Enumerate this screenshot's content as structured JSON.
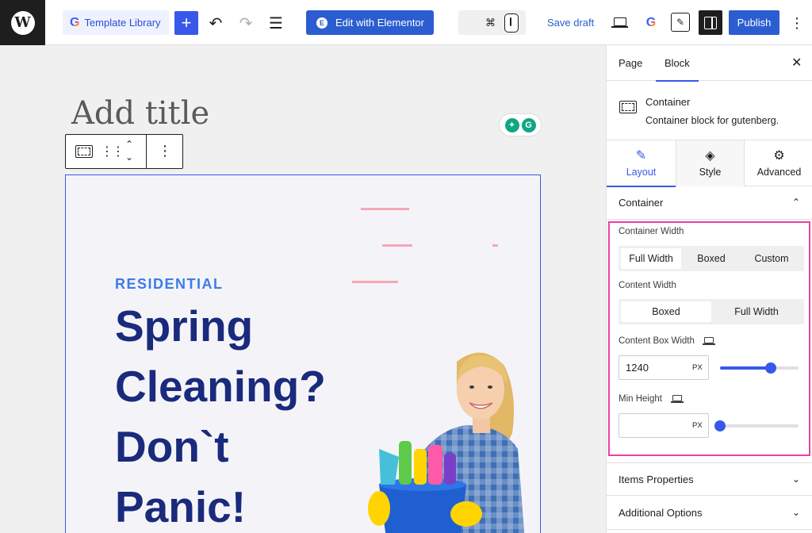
{
  "toolbar": {
    "template_library_label": "Template Library",
    "plus_label": "+",
    "undo_glyph": "↶",
    "redo_glyph": "↷",
    "list_view_glyph": "☰",
    "elementor_label": "Edit with Elementor",
    "cmd_key": "⌘",
    "save_draft_label": "Save draft",
    "publish_label": "Publish",
    "more_glyph": "⋮",
    "g_letter": "G",
    "pen_glyph": "✎",
    "wp_letter": "W",
    "icons": [
      "wordpress-logo-icon",
      "template-library-icon",
      "plus-icon",
      "undo-icon",
      "redo-icon",
      "list-view-icon",
      "elementor-icon",
      "command-icon",
      "mouse-scroll-icon",
      "desktop-preview-icon",
      "gutenverse-icon",
      "pen-icon",
      "settings-panel-icon",
      "more-options-icon"
    ]
  },
  "canvas": {
    "title_placeholder": "Add title",
    "grammarly_letter": "G",
    "block_toolbar": {
      "drag_glyph": "⋮⋮",
      "up_glyph": "⌃",
      "down_glyph": "⌄",
      "more_glyph": "⋮"
    },
    "hero": {
      "eyebrow": "RESIDENTIAL",
      "headline_lines": [
        "Spring",
        "Cleaning?",
        "Don`t",
        "Panic!"
      ]
    },
    "colors": {
      "eyebrow": "#3d7ce8",
      "headline": "#1a2a7c",
      "selection": "#3858e9",
      "decor": "#f6a7b4"
    }
  },
  "sidebar": {
    "tabs": [
      "Page",
      "Block"
    ],
    "active_tab": "Block",
    "close_glyph": "✕",
    "block_card": {
      "title": "Container",
      "description": "Container block for gutenberg."
    },
    "control_tabs": [
      {
        "label": "Layout",
        "icon": "brush-icon",
        "glyph": "✎"
      },
      {
        "label": "Style",
        "icon": "paint-bucket-icon",
        "glyph": "◈"
      },
      {
        "label": "Advanced",
        "icon": "gear-icon",
        "glyph": "⚙"
      }
    ],
    "active_control_tab": "Layout",
    "sections": {
      "container": {
        "title": "Container",
        "chevron": "⌃"
      },
      "items": {
        "title": "Items Properties",
        "chevron": "⌄"
      },
      "additional": {
        "title": "Additional Options",
        "chevron": "⌄"
      }
    },
    "container_width": {
      "label": "Container Width",
      "options": [
        "Full Width",
        "Boxed",
        "Custom"
      ],
      "selected": "Full Width"
    },
    "content_width": {
      "label": "Content Width",
      "options": [
        "Boxed",
        "Full Width"
      ],
      "selected": "Boxed"
    },
    "content_box_width": {
      "label": "Content Box Width",
      "value": "1240",
      "unit": "PX",
      "slider_percent": 65
    },
    "min_height": {
      "label": "Min Height",
      "value": "",
      "unit": "PX",
      "slider_percent": 0
    },
    "highlight_color": "#ec3fa4"
  }
}
